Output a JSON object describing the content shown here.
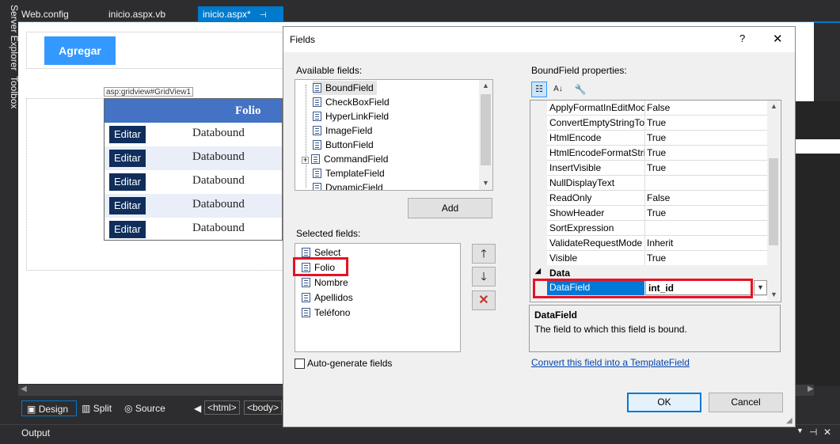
{
  "ide": {
    "side_tabs": [
      "Server Explorer",
      "Toolbox"
    ],
    "doc_tabs": [
      "Web.config",
      "inicio.aspx.vb",
      "inicio.aspx*"
    ],
    "pin_glyph": "⊣",
    "close_glyph": "✕",
    "agregar_label": "Agregar",
    "gridview_label": "asp:gridview#GridView1",
    "grid_header": "Folio",
    "grid_button": "Editar",
    "grid_cell": "Databound",
    "views": [
      "Design",
      "Split",
      "Source"
    ],
    "breadcrumbs": [
      "<html>",
      "<body>"
    ],
    "output_label": "Output"
  },
  "dialog": {
    "title": "Fields",
    "help": "?",
    "close": "✕",
    "available_label": "Available fields:",
    "available_fields": [
      "BoundField",
      "CheckBoxField",
      "HyperLinkField",
      "ImageField",
      "ButtonField",
      "CommandField",
      "TemplateField",
      "DynamicField"
    ],
    "add_button": "Add",
    "selected_label": "Selected fields:",
    "selected_fields": [
      "Select",
      "Folio",
      "Nombre",
      "Apellidos",
      "Teléfono"
    ],
    "autogen_label": "Auto-generate fields",
    "props_label": "BoundField properties:",
    "properties": [
      {
        "name": "ApplyFormatInEditMode",
        "value": "False"
      },
      {
        "name": "ConvertEmptyStringToNull",
        "value": "True"
      },
      {
        "name": "HtmlEncode",
        "value": "True"
      },
      {
        "name": "HtmlEncodeFormatString",
        "value": "True"
      },
      {
        "name": "InsertVisible",
        "value": "True"
      },
      {
        "name": "NullDisplayText",
        "value": ""
      },
      {
        "name": "ReadOnly",
        "value": "False"
      },
      {
        "name": "ShowHeader",
        "value": "True"
      },
      {
        "name": "SortExpression",
        "value": ""
      },
      {
        "name": "ValidateRequestMode",
        "value": "Inherit"
      },
      {
        "name": "Visible",
        "value": "True"
      }
    ],
    "category_data": "Data",
    "datafield_name": "DataField",
    "datafield_value": "int_id",
    "desc_title": "DataField",
    "desc_text": "The field to which this field is bound.",
    "convert_link": "Convert this field into a TemplateField",
    "ok_button": "OK",
    "cancel_button": "Cancel"
  },
  "colors": {
    "accent": "#007acc",
    "highlight": "#0078d7",
    "red": "#e81123"
  }
}
